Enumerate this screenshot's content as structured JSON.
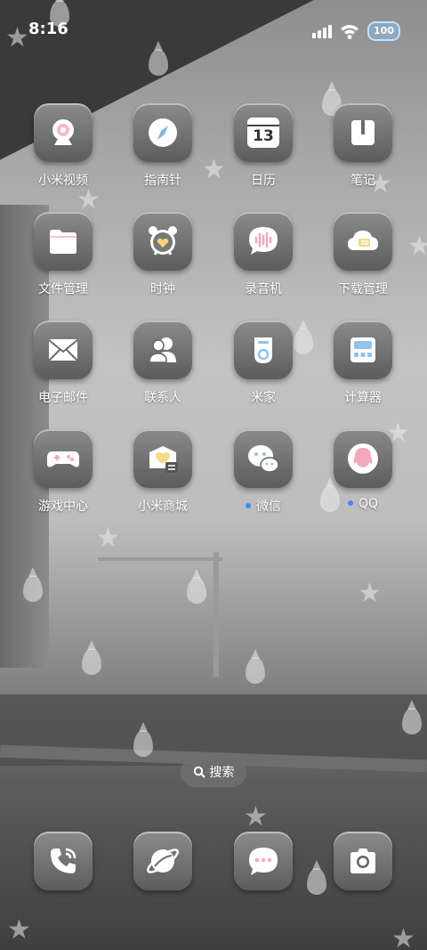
{
  "status_bar": {
    "time": "8:16",
    "battery_level": "100"
  },
  "apps": [
    {
      "label": "小米视频",
      "icon": "camera-icon"
    },
    {
      "label": "指南针",
      "icon": "compass-icon"
    },
    {
      "label": "日历",
      "icon": "calendar-icon",
      "badge_text": "13"
    },
    {
      "label": "笔记",
      "icon": "notebook-icon"
    },
    {
      "label": "文件管理",
      "icon": "folder-icon"
    },
    {
      "label": "时钟",
      "icon": "alarm-clock-icon"
    },
    {
      "label": "录音机",
      "icon": "voice-bubble-icon"
    },
    {
      "label": "下载管理",
      "icon": "cloud-download-icon"
    },
    {
      "label": "电子邮件",
      "icon": "mail-icon"
    },
    {
      "label": "联系人",
      "icon": "contacts-icon"
    },
    {
      "label": "米家",
      "icon": "smart-home-device-icon"
    },
    {
      "label": "计算器",
      "icon": "calculator-icon"
    },
    {
      "label": "游戏中心",
      "icon": "gamepad-icon"
    },
    {
      "label": "小米商城",
      "icon": "shop-icon"
    },
    {
      "label": "微信",
      "icon": "wechat-icon",
      "new_dot": true
    },
    {
      "label": "QQ",
      "icon": "qq-icon",
      "new_dot": true
    }
  ],
  "search": {
    "label": "搜索"
  },
  "dock": [
    {
      "icon": "phone-icon"
    },
    {
      "icon": "browser-globe-icon"
    },
    {
      "icon": "message-icon"
    },
    {
      "icon": "camera-shutter-icon"
    }
  ],
  "colors": {
    "icon_bg_top": "#8b8b8b",
    "icon_bg_bottom": "#5c5c5c",
    "notification_dot": "#3d8bff"
  }
}
